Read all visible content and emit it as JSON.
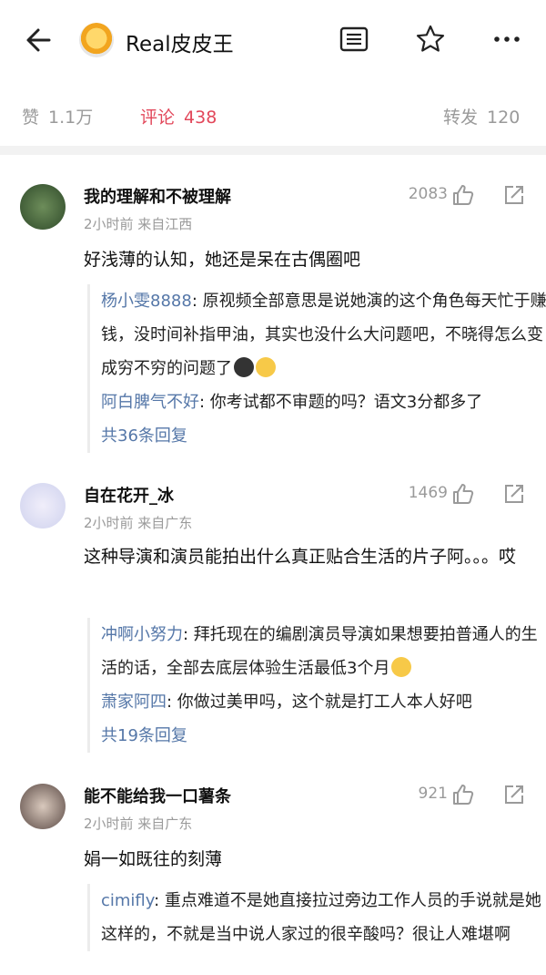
{
  "header": {
    "title": "Real皮皮王"
  },
  "stats": {
    "likes_label": "赞",
    "likes_value": "1.1万",
    "comments_label": "评论",
    "comments_value": "438",
    "reposts_label": "转发",
    "reposts_value": "120"
  },
  "comments": [
    {
      "name": "我的理解和不被理解",
      "meta": "2小时前  来自江西",
      "likes": "2083",
      "text": "好浅薄的认知，她还是呆在古偶圈吧",
      "replies": [
        {
          "name": "杨小雯8888",
          "text": ": 原视频全部意思是说她演的这个角色每天忙于赚钱，没时间补指甲油，其实也没什么大问题吧，不晓得怎么变成穷不穷的问题了"
        },
        {
          "name": "阿白脾气不好",
          "text": ": 你考试都不审题的吗？语文3分都多了"
        }
      ],
      "more": "共36条回复"
    },
    {
      "name": "自在花开_冰",
      "meta": "2小时前  来自广东",
      "likes": "1469",
      "text": "这种导演和演员能拍出什么真正贴合生活的片子阿。。。哎",
      "replies": [
        {
          "name": "冲啊小努力",
          "text": ": 拜托现在的编剧演员导演如果想要拍普通人的生活的话，全部去底层体验生活最低3个月"
        },
        {
          "name": "萧家阿四",
          "text": ": 你做过美甲吗，这个就是打工人本人好吧"
        }
      ],
      "more": "共19条回复"
    },
    {
      "name": "能不能给我一口薯条",
      "meta": "2小时前  来自广东",
      "likes": "921",
      "text": "娟一如既往的刻薄",
      "replies": [
        {
          "name": "cimifly",
          "text": ": 重点难道不是她直接拉过旁边工作人员的手说就是她这样的，不就是当中说人家过的很辛酸吗？很让人难堪啊"
        }
      ]
    }
  ]
}
